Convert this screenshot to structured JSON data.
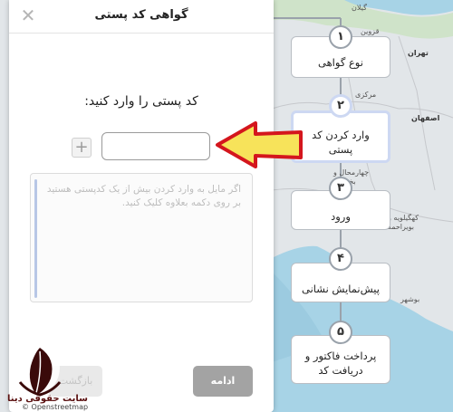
{
  "dialog": {
    "title": "گواهی کد پستی",
    "close_glyph": "✕",
    "prompt": "کد پستی را وارد کنید:",
    "plus_glyph": "+",
    "postal_input_value": "",
    "textarea_placeholder": "اگر مایل به وارد کردن بیش از یک کدپستی هستید بر روی دکمه بعلاوه کلیک کنید.",
    "back_label": "بازگشت",
    "continue_label": "ادامه"
  },
  "steps": [
    {
      "number": "۱",
      "label": "نوع گواهی",
      "active": false
    },
    {
      "number": "۲",
      "label": "وارد کردن کد پستی",
      "active": true
    },
    {
      "number": "۳",
      "label": "ورود",
      "active": false
    },
    {
      "number": "۴",
      "label": "پیش‌نمایش نشانی",
      "active": false
    },
    {
      "number": "۵",
      "label": "پرداخت فاکتور و دریافت کد",
      "active": false
    }
  ],
  "map": {
    "labels": [
      "گیلان",
      "قزوین",
      "تهران",
      "مرکزی",
      "اصفهان",
      "چهارمحال و بختیاری",
      "کهگیلویه و بویراحمد",
      "بوشهر"
    ],
    "credit": "© Openstreetmap"
  },
  "brand": {
    "logo_text": "سایت حقوقی دینا"
  },
  "colors": {
    "accent_border": "#cdd8f2",
    "arrow_fill": "#f7e35a",
    "arrow_stroke": "#d4161d",
    "continue_bg": "#a3a3a3"
  },
  "icons": {
    "close": "close-icon",
    "plus": "plus-icon",
    "arrow": "pointing-arrow-icon",
    "logo": "feather-logo-icon"
  }
}
